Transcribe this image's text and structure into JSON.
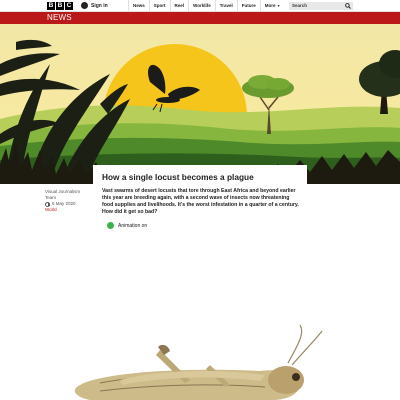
{
  "header": {
    "logo_letters": [
      "B",
      "B",
      "C"
    ],
    "signin_label": "Sign in",
    "nav": [
      "News",
      "Sport",
      "Reel",
      "Worklife",
      "Travel",
      "Future",
      "More"
    ],
    "search_placeholder": "Search"
  },
  "section_bar": {
    "label": "NEWS",
    "color": "#bb1919"
  },
  "article": {
    "headline": "How a single locust becomes a plague",
    "author_line1": "Visual Journalism",
    "author_line2": "Team",
    "date": "5 May 2020",
    "section": "World",
    "summary": "Vast swarms of desert locusts that tore through East Africa and beyond earlier this year are breeding again, with a second wave of insects now threatening food supplies and livelihoods. It's the worst infestation in a quarter of a century. How did it get so bad?",
    "animation_label": "Animation on",
    "animation_on": true
  },
  "colors": {
    "accent": "#bb1919",
    "toggle": "#3cb24a"
  }
}
